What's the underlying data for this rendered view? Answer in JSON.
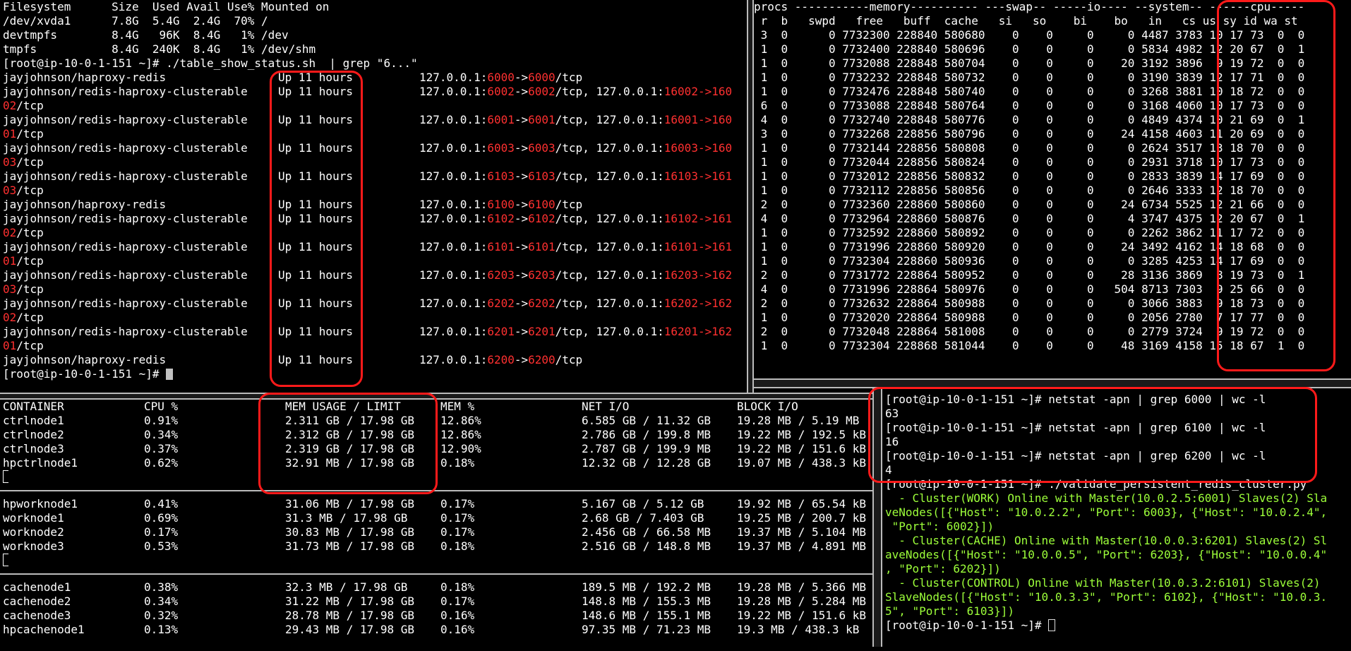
{
  "top_left": {
    "df_header": "Filesystem      Size  Used Avail Use% Mounted on",
    "df_rows": [
      "/dev/xvda1      7.8G  5.4G  2.4G  70% /",
      "devtmpfs        8.4G   96K  8.4G   1% /dev",
      "tmpfs           8.4G  240K  8.4G   1% /dev/shm"
    ],
    "prompt_cmd": "[root@ip-10-0-1-151 ~]# ./table_show_status.sh  | grep \"6...\"",
    "containers": [
      {
        "image": "jayjohnson/haproxy-redis",
        "status": "Up 11 hours",
        "p1": "6000",
        "p2": "6000",
        "suffix": "/tcp",
        "wrap": "",
        "wrap_tail": ""
      },
      {
        "image": "jayjohnson/redis-haproxy-clusterable",
        "status": "Up 11 hours",
        "p1": "6002",
        "p2": "6002",
        "suffix": "/tcp, 127.0.0.1:",
        "p3": "16002",
        "p3b": "->160",
        "wrap": "02",
        "wrap_tail": "/tcp"
      },
      {
        "image": "jayjohnson/redis-haproxy-clusterable",
        "status": "Up 11 hours",
        "p1": "6001",
        "p2": "6001",
        "suffix": "/tcp, 127.0.0.1:",
        "p3": "16001",
        "p3b": "->160",
        "wrap": "01",
        "wrap_tail": "/tcp"
      },
      {
        "image": "jayjohnson/redis-haproxy-clusterable",
        "status": "Up 11 hours",
        "p1": "6003",
        "p2": "6003",
        "suffix": "/tcp, 127.0.0.1:",
        "p3": "16003",
        "p3b": "->160",
        "wrap": "03",
        "wrap_tail": "/tcp"
      },
      {
        "image": "jayjohnson/redis-haproxy-clusterable",
        "status": "Up 11 hours",
        "p1": "6103",
        "p2": "6103",
        "suffix": "/tcp, 127.0.0.1:",
        "p3": "16103",
        "p3b": "->161",
        "wrap": "03",
        "wrap_tail": "/tcp"
      },
      {
        "image": "jayjohnson/haproxy-redis",
        "status": "Up 11 hours",
        "p1": "6100",
        "p2": "6100",
        "suffix": "/tcp",
        "wrap": "",
        "wrap_tail": ""
      },
      {
        "image": "jayjohnson/redis-haproxy-clusterable",
        "status": "Up 11 hours",
        "p1": "6102",
        "p2": "6102",
        "suffix": "/tcp, 127.0.0.1:",
        "p3": "16102",
        "p3b": "->161",
        "wrap": "02",
        "wrap_tail": "/tcp"
      },
      {
        "image": "jayjohnson/redis-haproxy-clusterable",
        "status": "Up 11 hours",
        "p1": "6101",
        "p2": "6101",
        "suffix": "/tcp, 127.0.0.1:",
        "p3": "16101",
        "p3b": "->161",
        "wrap": "01",
        "wrap_tail": "/tcp"
      },
      {
        "image": "jayjohnson/redis-haproxy-clusterable",
        "status": "Up 11 hours",
        "p1": "6203",
        "p2": "6203",
        "suffix": "/tcp, 127.0.0.1:",
        "p3": "16203",
        "p3b": "->162",
        "wrap": "03",
        "wrap_tail": "/tcp"
      },
      {
        "image": "jayjohnson/redis-haproxy-clusterable",
        "status": "Up 11 hours",
        "p1": "6202",
        "p2": "6202",
        "suffix": "/tcp, 127.0.0.1:",
        "p3": "16202",
        "p3b": "->162",
        "wrap": "02",
        "wrap_tail": "/tcp"
      },
      {
        "image": "jayjohnson/redis-haproxy-clusterable",
        "status": "Up 11 hours",
        "p1": "6201",
        "p2": "6201",
        "suffix": "/tcp, 127.0.0.1:",
        "p3": "16201",
        "p3b": "->162",
        "wrap": "01",
        "wrap_tail": "/tcp"
      },
      {
        "image": "jayjohnson/haproxy-redis",
        "status": "Up 11 hours",
        "p1": "6200",
        "p2": "6200",
        "suffix": "/tcp",
        "wrap": "",
        "wrap_tail": ""
      }
    ],
    "ip_prefix": "127.0.0.1:",
    "arrow": "->",
    "final_prompt": "[root@ip-10-0-1-151 ~]# "
  },
  "top_right": {
    "header1": "procs -----------memory---------- ---swap-- -----io---- --system-- ------cpu-----",
    "header2": " r  b   swpd   free   buff  cache   si   so    bi    bo   in   cs us sy id wa st",
    "rows": [
      " 3  0      0 7732300 228840 580680    0    0     0     0 4487 3783 10 17 73  0  0",
      " 1  0      0 7732400 228840 580696    0    0     0     0 5834 4982 12 20 67  0  1",
      " 1  0      0 7732088 228848 580704    0    0     0    20 3192 3896  9 19 72  0  0",
      " 1  0      0 7732232 228848 580732    0    0     0     0 3190 3839 12 17 71  0  0",
      " 1  0      0 7732476 228848 580740    0    0     0     0 3268 3881 10 18 72  0  0",
      " 6  0      0 7733088 228848 580764    0    0     0     0 3168 4060 10 17 73  0  0",
      " 4  0      0 7732740 228848 580776    0    0     0     0 4849 4374 10 21 69  0  1",
      " 3  0      0 7732268 228856 580796    0    0     0    24 4158 4603 11 20 69  0  0",
      " 1  0      0 7732144 228856 580808    0    0     0     0 2624 3517 13 18 70  0  0",
      " 1  0      0 7732044 228856 580824    0    0     0     0 2931 3718 10 17 73  0  0",
      " 1  0      0 7732012 228856 580832    0    0     0     0 2833 3839 14 17 69  0  0",
      " 1  0      0 7732112 228856 580856    0    0     0     0 2646 3333 12 18 70  0  0",
      " 2  0      0 7732360 228860 580860    0    0     0    24 6734 5525 12 21 66  0  0",
      " 4  0      0 7732964 228860 580876    0    0     0     4 3747 4375 12 20 67  0  1",
      " 1  0      0 7732592 228860 580892    0    0     0     0 2262 3862 11 17 72  0  0",
      " 1  0      0 7731996 228860 580920    0    0     0    24 3492 4162 14 18 68  0  0",
      " 1  0      0 7732304 228860 580936    0    0     0     0 3285 4253 14 17 69  0  0",
      " 2  0      0 7731772 228864 580952    0    0     0    28 3136 3869  8 19 73  0  1",
      " 4  0      0 7731996 228864 580976    0    0     0   504 8713 7303  9 25 66  0  0",
      " 2  0      0 7732632 228864 580988    0    0     0     0 3066 3883  9 18 73  0  0",
      " 1  0      0 7732020 228864 580988    0    0     0     0 2056 2780  7 17 77  0  0",
      " 2  0      0 7732048 228864 581008    0    0     0     0 2779 3724  9 19 72  0  0",
      " 1  0      0 7732304 228868 581044    0    0     0    48 3169 4158 15 18 67  1  0"
    ]
  },
  "bottom_left": {
    "headers": [
      "CONTAINER",
      "CPU %",
      "MEM USAGE / LIMIT",
      "MEM %",
      "NET I/O",
      "BLOCK I/O"
    ],
    "groups": [
      [
        [
          "ctrlnode1",
          "0.91%",
          "2.311 GB / 17.98 GB",
          "12.86%",
          "6.585 GB / 11.32 GB",
          "19.28 MB / 5.19 MB"
        ],
        [
          "ctrlnode2",
          "0.34%",
          "2.312 GB / 17.98 GB",
          "12.86%",
          "2.786 GB / 199.8 MB",
          "19.22 MB / 192.5 kB"
        ],
        [
          "ctrlnode3",
          "0.37%",
          "2.319 GB / 17.98 GB",
          "12.90%",
          "2.787 GB / 199.9 MB",
          "19.22 MB / 151.6 kB"
        ],
        [
          "hpctrlnode1",
          "0.62%",
          "32.91 MB / 17.98 GB",
          "0.18%",
          "12.32 GB / 12.28 GB",
          "19.07 MB / 438.3 kB"
        ]
      ],
      [
        [
          "hpworknode1",
          "0.41%",
          "31.06 MB / 17.98 GB",
          "0.17%",
          "5.167 GB / 5.12 GB",
          "19.92 MB / 65.54 kB"
        ],
        [
          "worknode1",
          "0.69%",
          "31.3 MB / 17.98 GB",
          "0.17%",
          "2.68 GB / 7.403 GB",
          "19.25 MB / 200.7 kB"
        ],
        [
          "worknode2",
          "0.17%",
          "30.83 MB / 17.98 GB",
          "0.17%",
          "2.456 GB / 66.58 MB",
          "19.37 MB / 5.104 MB"
        ],
        [
          "worknode3",
          "0.53%",
          "31.73 MB / 17.98 GB",
          "0.18%",
          "2.516 GB / 148.8 MB",
          "19.37 MB / 4.891 MB"
        ]
      ],
      [
        [
          "cachenode1",
          "0.38%",
          "32.3 MB / 17.98 GB",
          "0.18%",
          "189.5 MB / 192.2 MB",
          "19.28 MB / 5.366 MB"
        ],
        [
          "cachenode2",
          "0.34%",
          "31.22 MB / 17.98 GB",
          "0.17%",
          "148.8 MB / 155.3 MB",
          "19.28 MB / 5.284 MB"
        ],
        [
          "cachenode3",
          "0.32%",
          "28.78 MB / 17.98 GB",
          "0.16%",
          "148.6 MB / 155.1 MB",
          "19.22 MB / 151.6 kB"
        ],
        [
          "hpcachenode1",
          "0.13%",
          "29.43 MB / 17.98 GB",
          "0.16%",
          "97.35 MB / 71.23 MB",
          "19.3 MB / 438.3 kB"
        ]
      ]
    ]
  },
  "bottom_right": {
    "lines": [
      {
        "text": "[root@ip-10-0-1-151 ~]# netstat -apn | grep 6000 | wc -l",
        "green": false
      },
      {
        "text": "63",
        "green": false
      },
      {
        "text": "[root@ip-10-0-1-151 ~]# netstat -apn | grep 6100 | wc -l",
        "green": false
      },
      {
        "text": "16",
        "green": false
      },
      {
        "text": "[root@ip-10-0-1-151 ~]# netstat -apn | grep 6200 | wc -l",
        "green": false
      },
      {
        "text": "4",
        "green": false
      },
      {
        "text": "[root@ip-10-0-1-151 ~]# ./validate_persistent_redis_cluster.py",
        "green": false
      },
      {
        "text": "  - Cluster(WORK) Online with Master(10.0.2.5:6001) Slaves(2) Sla",
        "green": true
      },
      {
        "text": "veNodes([{\"Host\": \"10.0.2.2\", \"Port\": 6003}, {\"Host\": \"10.0.2.4\",",
        "green": true
      },
      {
        "text": " \"Port\": 6002}])",
        "green": true
      },
      {
        "text": "  - Cluster(CACHE) Online with Master(10.0.0.3:6201) Slaves(2) Sl",
        "green": true
      },
      {
        "text": "aveNodes([{\"Host\": \"10.0.0.5\", \"Port\": 6203}, {\"Host\": \"10.0.0.4\"",
        "green": true
      },
      {
        "text": ", \"Port\": 6202}])",
        "green": true
      },
      {
        "text": "  - Cluster(CONTROL) Online with Master(10.0.3.2:6101) Slaves(2)",
        "green": true
      },
      {
        "text": "SlaveNodes([{\"Host\": \"10.0.3.3\", \"Port\": 6102}, {\"Host\": \"10.0.3.",
        "green": true
      },
      {
        "text": "5\", \"Port\": 6103}])",
        "green": true
      }
    ],
    "final_prompt": "[root@ip-10-0-1-151 ~]# "
  }
}
